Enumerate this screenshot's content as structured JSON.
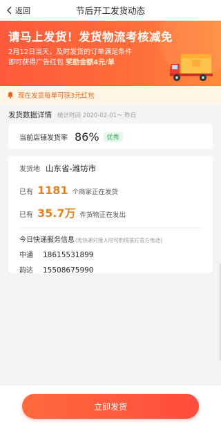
{
  "nav": {
    "back_label": "返回",
    "title": "节后开工发货动态"
  },
  "banner": {
    "title": "请马上发货！发货物流考核减免",
    "line1": "2月12日当天，及时发货的订单满足条件",
    "line2_prefix": "即可获得广告红包",
    "line2_highlight": "奖励金额4元/单",
    "colors": {
      "gradient_start": "#ff5a3c",
      "gradient_end": "#ff8a3a"
    }
  },
  "notice": {
    "icon": "bell-icon",
    "text": "现在发货每单可获3元红包"
  },
  "data_section": {
    "title": "发货数据详情",
    "subtitle": "统计时间 2020-02-01～ 昨日"
  },
  "rate_card": {
    "label": "当前店铺发货率",
    "value": "86%",
    "badge": "优秀"
  },
  "main_card": {
    "origin_label": "发货地",
    "origin_value": "山东省-潍坊市",
    "stats": [
      {
        "prefix": "已有",
        "value": "1181",
        "text": "个商家正在发货"
      },
      {
        "prefix": "已有",
        "value": "35.7万",
        "text": "件货物正在发出"
      }
    ],
    "express_title": "今日快递服务信息",
    "express_note": "(无快递对接人时可酌情拨打官方电话)",
    "express": [
      {
        "name": "中通",
        "phone": "18615531899"
      },
      {
        "name": "韵达",
        "phone": "15508675990"
      }
    ]
  },
  "footer": {
    "ship_button": "立即发货",
    "accent": "#ff5a3d"
  }
}
